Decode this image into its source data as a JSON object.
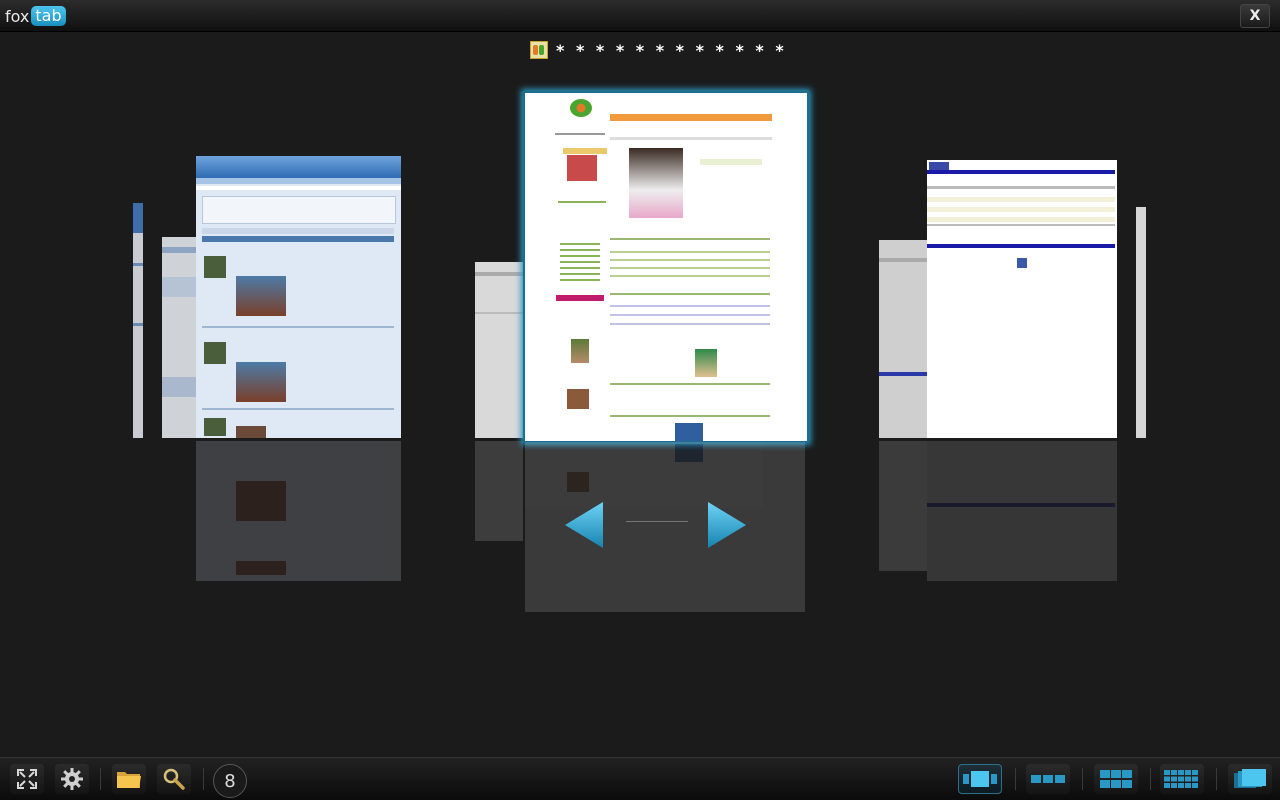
{
  "app": {
    "logo_fox": "fox",
    "logo_tab": "tab",
    "close_label": "X"
  },
  "preview": {
    "title": "* * * * * * * * * * * *",
    "favicon": "site-favicon-icon"
  },
  "toolbar": {
    "tab_count": "8",
    "left_buttons": [
      "fullscreen-icon",
      "settings-gear-icon",
      "folder-icon",
      "search-magnifier-icon"
    ],
    "view_buttons": [
      "view-3d-carousel-icon",
      "view-row-icon",
      "view-grid-icon",
      "view-dense-grid-icon",
      "view-stack-icon"
    ]
  },
  "colors": {
    "accent": "#2a98c4",
    "background": "#1b1b1b"
  }
}
